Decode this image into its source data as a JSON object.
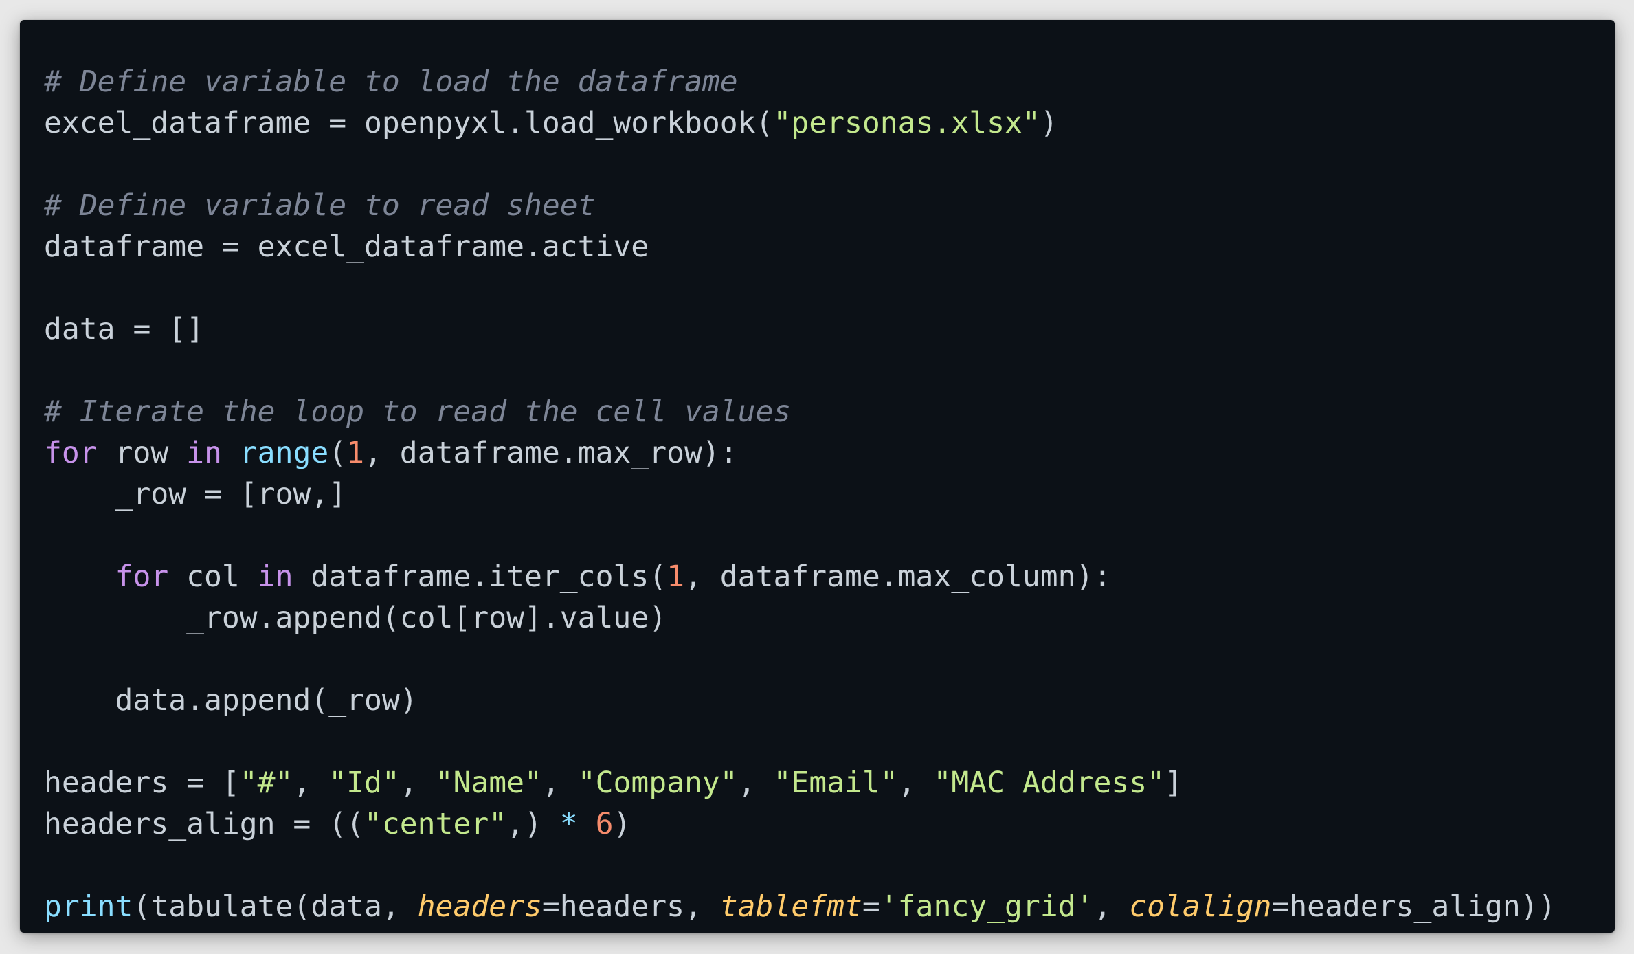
{
  "lines": [
    [
      {
        "t": "# Define variable to load the dataframe",
        "c": "comment",
        "n": "comment-load-dataframe"
      }
    ],
    [
      {
        "t": "excel_dataframe = openpyxl.load_workbook(",
        "c": "plain"
      },
      {
        "t": "\"personas.xlsx\"",
        "c": "str",
        "n": "filename-string"
      },
      {
        "t": ")",
        "c": "plain"
      }
    ],
    [],
    [
      {
        "t": "# Define variable to read sheet",
        "c": "comment",
        "n": "comment-read-sheet"
      }
    ],
    [
      {
        "t": "dataframe = excel_dataframe.active",
        "c": "plain"
      }
    ],
    [],
    [
      {
        "t": "data = []",
        "c": "plain"
      }
    ],
    [],
    [
      {
        "t": "# Iterate the loop to read the cell values",
        "c": "comment",
        "n": "comment-iterate-loop"
      }
    ],
    [
      {
        "t": "for",
        "c": "kw",
        "n": "keyword-for"
      },
      {
        "t": " row ",
        "c": "plain"
      },
      {
        "t": "in",
        "c": "kw",
        "n": "keyword-in"
      },
      {
        "t": " ",
        "c": "plain"
      },
      {
        "t": "range",
        "c": "builtin",
        "n": "builtin-range"
      },
      {
        "t": "(",
        "c": "plain"
      },
      {
        "t": "1",
        "c": "num",
        "n": "number-literal"
      },
      {
        "t": ", dataframe.max_row):",
        "c": "plain"
      }
    ],
    [
      {
        "t": "    _row = [row,]",
        "c": "plain"
      }
    ],
    [],
    [
      {
        "t": "    ",
        "c": "plain"
      },
      {
        "t": "for",
        "c": "kw",
        "n": "keyword-for"
      },
      {
        "t": " col ",
        "c": "plain"
      },
      {
        "t": "in",
        "c": "kw",
        "n": "keyword-in"
      },
      {
        "t": " dataframe.iter_cols(",
        "c": "plain"
      },
      {
        "t": "1",
        "c": "num",
        "n": "number-literal"
      },
      {
        "t": ", dataframe.max_column):",
        "c": "plain"
      }
    ],
    [
      {
        "t": "        _row.append(col[row].value)",
        "c": "plain"
      }
    ],
    [],
    [
      {
        "t": "    data.append(_row)",
        "c": "plain"
      }
    ],
    [],
    [
      {
        "t": "headers = [",
        "c": "plain"
      },
      {
        "t": "\"#\"",
        "c": "str",
        "n": "header-string"
      },
      {
        "t": ", ",
        "c": "plain"
      },
      {
        "t": "\"Id\"",
        "c": "str",
        "n": "header-string"
      },
      {
        "t": ", ",
        "c": "plain"
      },
      {
        "t": "\"Name\"",
        "c": "str",
        "n": "header-string"
      },
      {
        "t": ", ",
        "c": "plain"
      },
      {
        "t": "\"Company\"",
        "c": "str",
        "n": "header-string"
      },
      {
        "t": ", ",
        "c": "plain"
      },
      {
        "t": "\"Email\"",
        "c": "str",
        "n": "header-string"
      },
      {
        "t": ", ",
        "c": "plain"
      },
      {
        "t": "\"MAC Address\"",
        "c": "str",
        "n": "header-string"
      },
      {
        "t": "]",
        "c": "plain"
      }
    ],
    [
      {
        "t": "headers_align = ((",
        "c": "plain"
      },
      {
        "t": "\"center\"",
        "c": "str",
        "n": "align-string"
      },
      {
        "t": ",) ",
        "c": "plain"
      },
      {
        "t": "*",
        "c": "op",
        "n": "multiply-operator"
      },
      {
        "t": " ",
        "c": "plain"
      },
      {
        "t": "6",
        "c": "num",
        "n": "number-literal"
      },
      {
        "t": ")",
        "c": "plain"
      }
    ],
    [],
    [
      {
        "t": "print",
        "c": "builtin",
        "n": "builtin-print"
      },
      {
        "t": "(tabulate(data, ",
        "c": "plain"
      },
      {
        "t": "headers",
        "c": "param",
        "n": "kwarg-headers"
      },
      {
        "t": "=headers, ",
        "c": "plain"
      },
      {
        "t": "tablefmt",
        "c": "param",
        "n": "kwarg-tablefmt"
      },
      {
        "t": "=",
        "c": "plain"
      },
      {
        "t": "'fancy_grid'",
        "c": "str",
        "n": "tablefmt-string"
      },
      {
        "t": ", ",
        "c": "plain"
      },
      {
        "t": "colalign",
        "c": "param",
        "n": "kwarg-colalign"
      },
      {
        "t": "=headers_align))",
        "c": "plain"
      }
    ]
  ],
  "colors": {
    "background": "#0c1117",
    "page": "#e8e8e8",
    "comment": "#7d8596",
    "string": "#c3e88d",
    "keyword": "#c792ea",
    "builtin": "#89ddff",
    "number": "#f78c6c",
    "param": "#ffcb6b",
    "text": "#c9d1d9"
  }
}
